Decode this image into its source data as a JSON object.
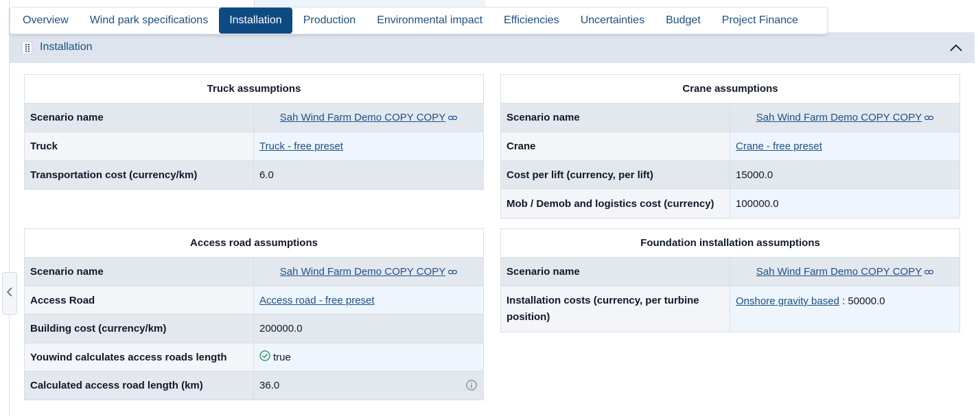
{
  "tabs": [
    {
      "label": "Overview",
      "active": false
    },
    {
      "label": "Wind park specifications",
      "active": false
    },
    {
      "label": "Installation",
      "active": true
    },
    {
      "label": "Production",
      "active": false
    },
    {
      "label": "Environmental impact",
      "active": false
    },
    {
      "label": "Efficiencies",
      "active": false
    },
    {
      "label": "Uncertainties",
      "active": false
    },
    {
      "label": "Budget",
      "active": false
    },
    {
      "label": "Project Finance",
      "active": false
    }
  ],
  "section": {
    "title": "Installation",
    "drag_icon": "grip-vertical-icon",
    "collapse_icon": "chevron-up-icon"
  },
  "side_toggle_icon": "chevron-left-icon",
  "truck": {
    "title": "Truck assumptions",
    "scenario_label": "Scenario name",
    "scenario_value": "Sah Wind Farm Demo COPY COPY",
    "truck_label": "Truck",
    "truck_value": "Truck - free preset",
    "cost_label": "Transportation cost (currency/km)",
    "cost_value": "6.0"
  },
  "crane": {
    "title": "Crane assumptions",
    "scenario_label": "Scenario name",
    "scenario_value": "Sah Wind Farm Demo COPY COPY",
    "crane_label": "Crane",
    "crane_value": "Crane - free preset",
    "lift_label": "Cost per lift (currency, per lift)",
    "lift_value": "15000.0",
    "mob_label": "Mob / Demob and logistics cost (currency)",
    "mob_value": "100000.0"
  },
  "access": {
    "title": "Access road assumptions",
    "scenario_label": "Scenario name",
    "scenario_value": "Sah Wind Farm Demo COPY COPY",
    "road_label": "Access Road",
    "road_value": "Access road - free preset",
    "building_label": "Building cost (currency/km)",
    "building_value": "200000.0",
    "calc_label": "Youwind calculates access roads length",
    "calc_value": "true",
    "length_label": "Calculated access road length (km)",
    "length_value": "36.0"
  },
  "foundation": {
    "title": "Foundation installation assumptions",
    "scenario_label": "Scenario name",
    "scenario_value": "Sah Wind Farm Demo COPY COPY",
    "install_label": "Installation costs (currency, per turbine position)",
    "install_link": "Onshore gravity based",
    "install_value": " : 50000.0"
  },
  "colors": {
    "active_tab": "#0e4a82",
    "link": "#1d4f86",
    "header_bg": "#dde4ee",
    "success": "#1a8f55"
  }
}
